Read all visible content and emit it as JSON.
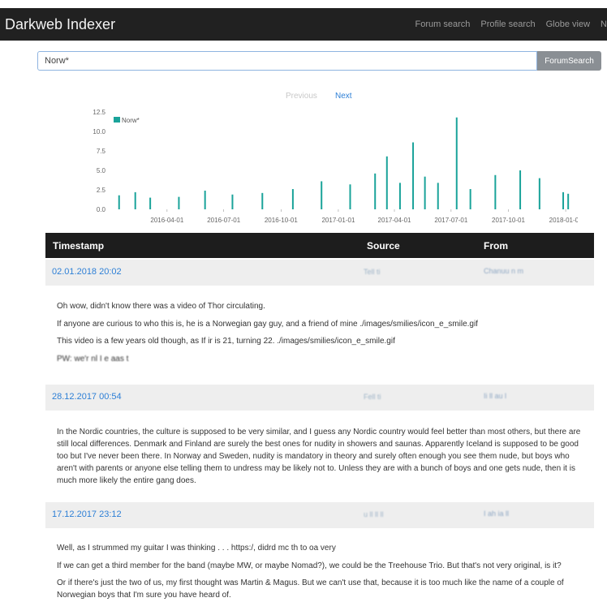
{
  "navbar": {
    "brand": "Darkweb Indexer",
    "links": [
      "Forum search",
      "Profile search",
      "Globe view",
      "N"
    ]
  },
  "search": {
    "value": "Norw*",
    "button_label": "ForumSearch"
  },
  "pager": {
    "previous": "Previous",
    "next": "Next"
  },
  "chart_data": {
    "type": "bar",
    "legend": [
      "Norw*"
    ],
    "series_color": "#1aa39a",
    "x_tick_labels": [
      "2016-04-01",
      "2016-07-01",
      "2016-10-01",
      "2017-01-01",
      "2017-04-01",
      "2017-07-01",
      "2017-10-01",
      "2018-01-01"
    ],
    "y_tick_labels": [
      "0.0",
      "2.5",
      "5.0",
      "7.5",
      "10.0",
      "12.5"
    ],
    "ylim": [
      0,
      12.5
    ],
    "x_range": [
      "2016-01-01",
      "2018-01-10"
    ],
    "daily_counts_sample": [
      {
        "date": "2016-01-15",
        "value": 1.8
      },
      {
        "date": "2016-02-10",
        "value": 2.2
      },
      {
        "date": "2016-03-05",
        "value": 1.5
      },
      {
        "date": "2016-04-20",
        "value": 1.6
      },
      {
        "date": "2016-06-01",
        "value": 2.4
      },
      {
        "date": "2016-07-15",
        "value": 1.9
      },
      {
        "date": "2016-09-01",
        "value": 2.1
      },
      {
        "date": "2016-10-20",
        "value": 2.6
      },
      {
        "date": "2016-12-05",
        "value": 3.6
      },
      {
        "date": "2017-01-20",
        "value": 3.2
      },
      {
        "date": "2017-03-01",
        "value": 4.6
      },
      {
        "date": "2017-03-20",
        "value": 6.8
      },
      {
        "date": "2017-04-10",
        "value": 3.4
      },
      {
        "date": "2017-05-01",
        "value": 8.6
      },
      {
        "date": "2017-05-20",
        "value": 4.2
      },
      {
        "date": "2017-06-10",
        "value": 3.4
      },
      {
        "date": "2017-07-10",
        "value": 11.8
      },
      {
        "date": "2017-08-01",
        "value": 2.6
      },
      {
        "date": "2017-09-10",
        "value": 4.4
      },
      {
        "date": "2017-10-20",
        "value": 5.0
      },
      {
        "date": "2017-11-20",
        "value": 4.0
      },
      {
        "date": "2017-12-28",
        "value": 2.2
      },
      {
        "date": "2018-01-05",
        "value": 2.0
      }
    ],
    "grid": false,
    "legend_position": "top-left"
  },
  "table": {
    "headers": [
      "Timestamp",
      "Source",
      "From"
    ],
    "posts": [
      {
        "timestamp": "02.01.2018 20:02",
        "source": "Tell ti",
        "from": "Chanuu n m",
        "paragraphs": [
          "Oh wow, didn't know there was a video of Thor circulating.",
          "If anyone are curious to who this is, he is a Norwegian gay guy, and a friend of mine ./images/smilies/icon_e_smile.gif",
          "This video is a few years old though, as   If ir is 21, turning 22. ./images/smilies/icon_e_smile.gif",
          "PW: we'r nl  I e aas t"
        ]
      },
      {
        "timestamp": "28.12.2017 00:54",
        "source": "Fell ti",
        "from": "Ii ll  au l",
        "paragraphs": [
          "In the Nordic countries, the culture is supposed to be very similar, and I guess any Nordic country would feel better than most others, but there are still local differences. Denmark and Finland are surely the best ones for nudity in showers and saunas. Apparently Iceland is supposed to be good too but I've never been there. In Norway and Sweden, nudity is mandatory in theory and surely often enough you see them nude, but boys who aren't with parents or anyone else telling them to undress may be likely not to. Unless they are with a bunch of boys and one gets nude, then it is much more likely the entire gang does."
        ]
      },
      {
        "timestamp": "17.12.2017 23:12",
        "source": "u ll ll ll",
        "from": "I ah ia ll",
        "paragraphs": [
          "Well, as I strummed my guitar I was thinking . . . https:/, didrd mc th to oa very",
          "If we can get a third member for the band (maybe MW, or maybe Nomad?), we could be the Treehouse Trio. But that's not very original, is it?",
          "Or if there's just the two of us, my first thought was Martin & Magus. But we can't use that, because it is too much like the name of a couple of Norwegian boys that I'm sure you have heard of."
        ]
      }
    ]
  }
}
